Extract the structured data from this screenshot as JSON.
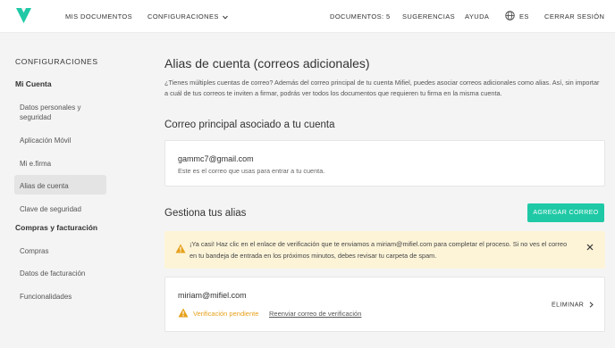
{
  "header": {
    "nav_documents": "MIS DOCUMENTOS",
    "nav_settings": "CONFIGURACIONES",
    "nav_doc_count": "DOCUMENTOS: 5",
    "nav_suggestions": "SUGERENCIAS",
    "nav_help": "AYUDA",
    "lang": "ES",
    "logout": "CERRAR SESIÓN"
  },
  "sidebar": {
    "title": "CONFIGURACIONES",
    "section_account": "Mi Cuenta",
    "personal_data": "Datos personales y seguridad",
    "mobile_app": "Aplicación Móvil",
    "efirma": "Mi e.firma",
    "alias": "Alias de cuenta",
    "security_key": "Clave de seguridad",
    "section_billing": "Compras y facturación",
    "purchases": "Compras",
    "billing_data": "Datos de facturación",
    "features": "Funcionalidades"
  },
  "main": {
    "title": "Alias de cuenta (correos adicionales)",
    "intro": "¿Tienes múltiples cuentas de correo? Además del correo principal de tu cuenta Mifiel, puedes asociar correos adicionales como alias. Así, sin importar a cuál de tus correos te inviten a firmar, podrás ver todos los documentos que requieren tu firma en la misma cuenta.",
    "primary_heading": "Correo principal asociado a tu cuenta",
    "primary_email": "gammc7@gmail.com",
    "primary_note": "Este es el correo que usas para entrar a tu cuenta.",
    "manage_heading": "Gestiona tus alias",
    "add_button": "AGREGAR CORREO",
    "alert_text": "¡Ya casi! Haz clic en el enlace de verificación que te enviamos a miriam@mifiel.com para completar el proceso. Si no ves el correo en tu bandeja de entrada en los próximos minutos, debes revisar tu carpeta de spam.",
    "alias_email": "miriam@mifiel.com",
    "pending_label": "Verificación pendiente",
    "resend_label": "Reenviar correo de verificación",
    "delete_label": "ELIMINAR"
  },
  "colors": {
    "accent": "#1fc9a6",
    "warning": "#e6a01b",
    "alert_bg": "#fdf4d8"
  },
  "icons": [
    "mifiel-logo-icon",
    "chevron-down-icon",
    "globe-icon",
    "warning-icon",
    "close-icon",
    "chevron-right-icon"
  ]
}
